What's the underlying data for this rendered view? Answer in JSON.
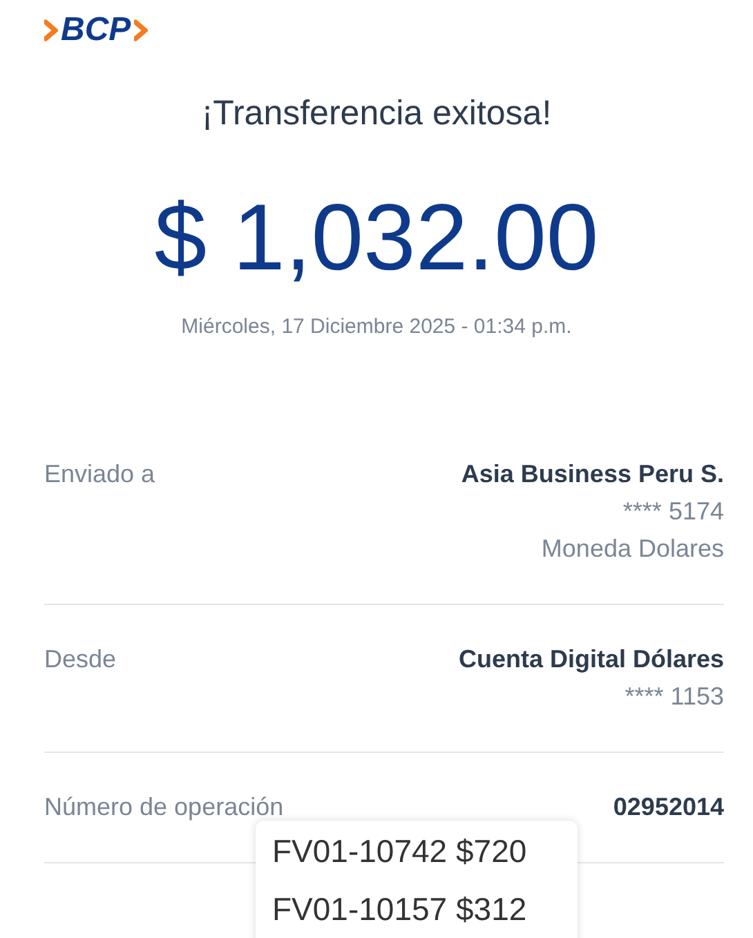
{
  "logo": {
    "text": "BCP"
  },
  "title": "¡Transferencia exitosa!",
  "amount": "$ 1,032.00",
  "date": "Miércoles, 17 Diciembre 2025 - 01:34 p.m.",
  "details": [
    {
      "label": "Enviado a",
      "value": "Asia Business Peru S.",
      "lines": [
        "**** 5174",
        "Moneda Dolares"
      ]
    },
    {
      "label": "Desde",
      "value": "Cuenta Digital Dólares",
      "lines": [
        "**** 1153"
      ]
    },
    {
      "label": "Número de operación",
      "value": "02952014"
    }
  ],
  "popup": {
    "items": [
      "FV01-10742 $720",
      "FV01-10157 $312"
    ]
  }
}
